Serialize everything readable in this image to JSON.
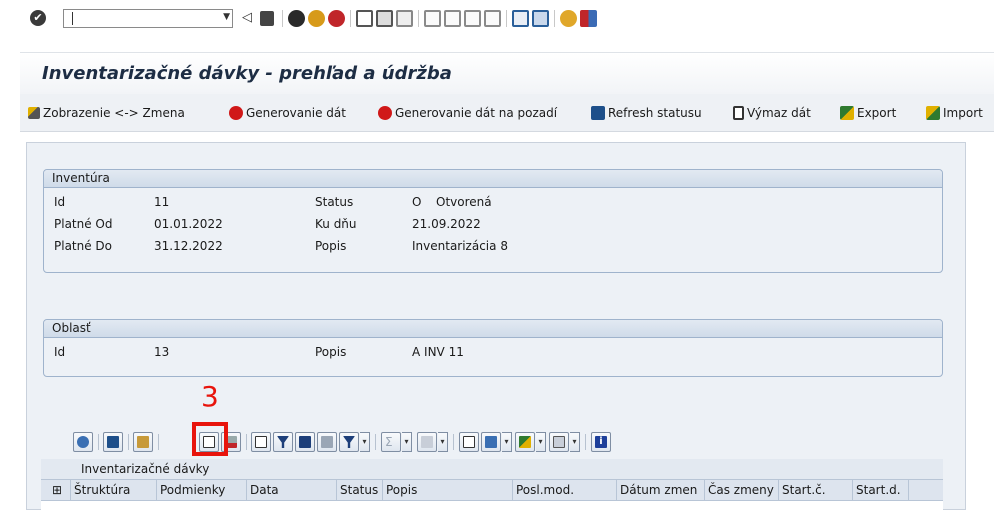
{
  "system_toolbar": {
    "icons": [
      "ok-icon",
      "back-icon",
      "save-icon",
      "navigate-back-icon",
      "exit-icon",
      "cancel-icon",
      "print-icon",
      "find-icon",
      "find-next-icon",
      "first-page-icon",
      "previous-page-icon",
      "next-page-icon",
      "last-page-icon",
      "new-session-icon",
      "shortcut-icon",
      "help-icon",
      "layout-icon"
    ],
    "command_field_value": ""
  },
  "title": "Inventarizačné dávky - prehľad a údržba",
  "app_toolbar": {
    "items": [
      {
        "label": "Zobrazenie <-> Zmena",
        "icon": "display-change-icon"
      },
      {
        "label": "Generovanie dát",
        "icon": "execute-icon"
      },
      {
        "label": "Generovanie dát na pozadí",
        "icon": "execute-background-icon"
      },
      {
        "label": "Refresh statusu",
        "icon": "refresh-icon"
      },
      {
        "label": "Výmaz dát",
        "icon": "trash-icon"
      },
      {
        "label": "Export",
        "icon": "export-icon"
      },
      {
        "label": "Import",
        "icon": "import-icon"
      }
    ]
  },
  "inventura": {
    "header": "Inventúra",
    "id_label": "Id",
    "id_value": "11",
    "platne_od_label": "Platné Od",
    "platne_od_value": "01.01.2022",
    "platne_do_label": "Platné Do",
    "platne_do_value": "31.12.2022",
    "status_label": "Status",
    "status_code": "O",
    "status_text": "Otvorená",
    "ku_dnu_label": "Ku dňu",
    "ku_dnu_value": "21.09.2022",
    "popis_label": "Popis",
    "popis_value": "Inventarizácia 8"
  },
  "oblast": {
    "header": "Oblasť",
    "id_label": "Id",
    "id_value": "13",
    "popis_label": "Popis",
    "popis_value": "A INV 11"
  },
  "callout": "3",
  "alv": {
    "title": "Inventarizačné dávky",
    "columns": [
      "Štruktúra",
      "Podmienky",
      "Data",
      "Status",
      "Popis",
      "Posl.mod.",
      "Dátum zmen",
      "Čas zmeny",
      "Start.č.",
      "Start.d."
    ]
  },
  "colors": {
    "highlight": "#e8140c",
    "title_text": "#1d2d44",
    "panel_bg": "#edf1f6"
  }
}
